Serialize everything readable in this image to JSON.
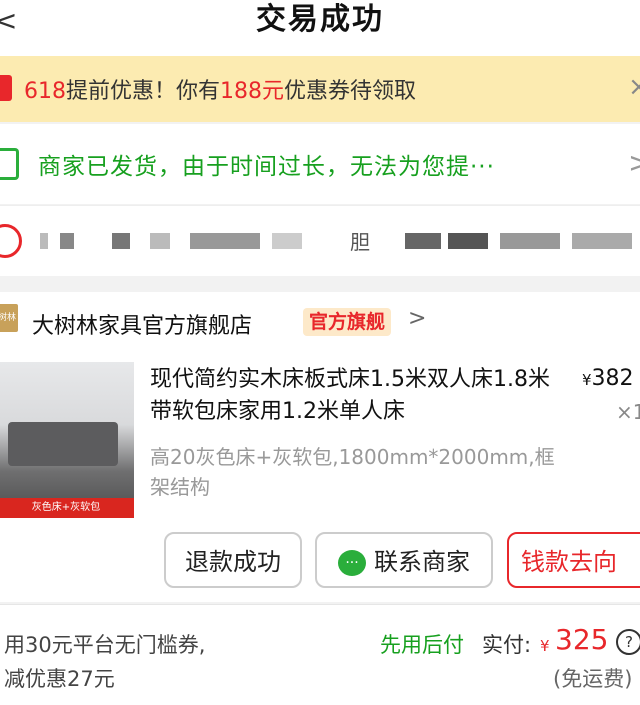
{
  "header": {
    "title": "交易成功",
    "back_glyph": "<"
  },
  "promo": {
    "tag": "618",
    "text_a": "提前优惠！你有",
    "amount": "188元",
    "text_b": "优惠券待领取",
    "close_glyph": "×"
  },
  "shipping": {
    "text": "商家已发货，由于时间过长，无法为您提···",
    "arrow_glyph": ">"
  },
  "address": {
    "char": "胆"
  },
  "store": {
    "logo_text": "树林",
    "name": "大树林家具官方旗舰店",
    "badge": "官方旗舰",
    "arrow_glyph": ">"
  },
  "product": {
    "title": "现代简约实木床板式床1.5米双人床1.8米带软包床家用1.2米单人床",
    "price_symbol": "¥",
    "price": "382",
    "qty": "×1",
    "spec": "高20灰色床+灰软包,1800mm*2000mm,框架结构",
    "thumb_caption": "灰色床+灰软包"
  },
  "actions": {
    "refund": "退款成功",
    "contact": "联系商家",
    "money": "钱款去向"
  },
  "footer": {
    "coupon_line1": "用30元平台无门槛券,",
    "coupon_line2": "减优惠27元",
    "pay_later": "先用后付",
    "paid_label": "实付:",
    "yen": "¥",
    "paid_amount": "325",
    "free_shipping": "(免运费)"
  },
  "colors": {
    "accent_red": "#e8272b",
    "green": "#17a01f",
    "promo_bg": "#fcebb1"
  },
  "icons": [
    "back-icon",
    "coupon-icon",
    "close-icon",
    "truck-icon",
    "chevron-right-icon",
    "location-icon",
    "store-logo",
    "wechat-icon",
    "help-icon"
  ]
}
